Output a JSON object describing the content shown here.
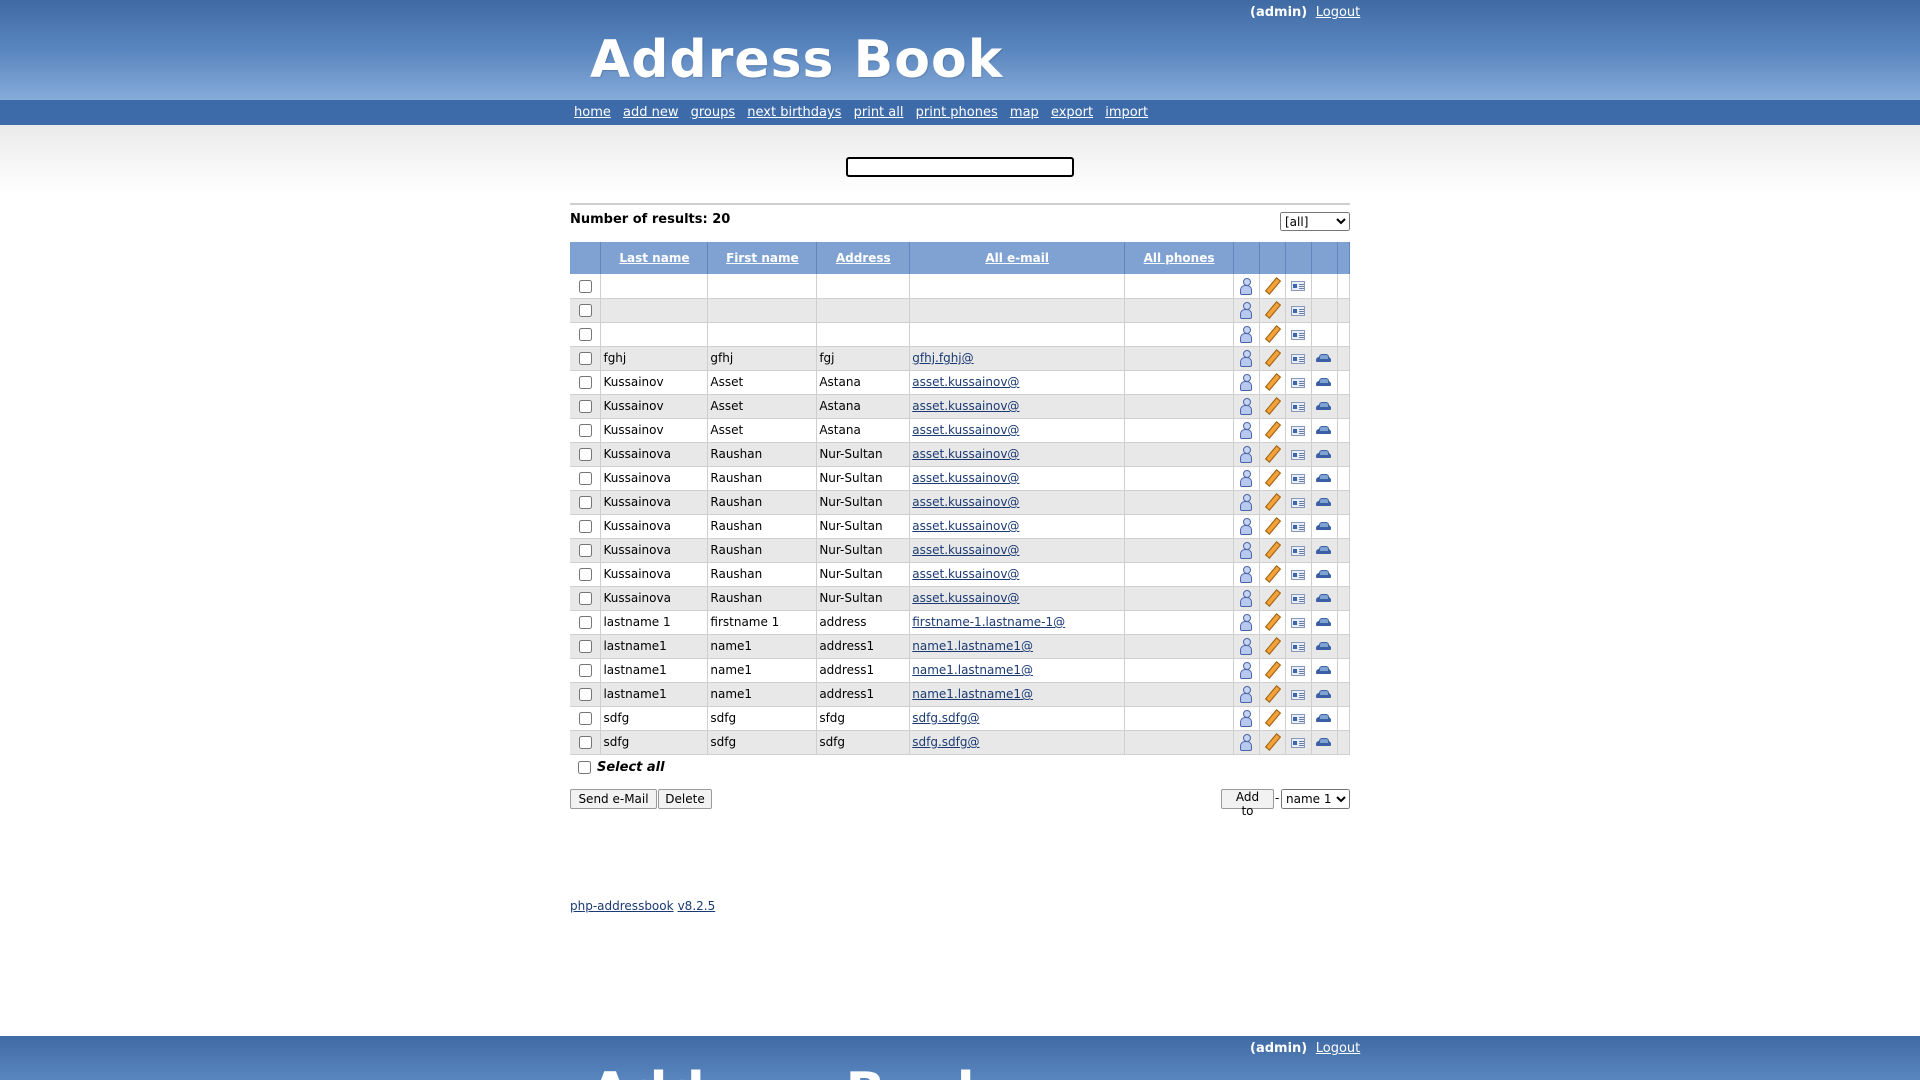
{
  "header": {
    "user_label": "(admin)",
    "logout_label": "Logout",
    "logo_text": "Address Book"
  },
  "nav": {
    "items": [
      "home",
      "add new",
      "groups",
      "next birthdays",
      "print all",
      "print phones",
      "map",
      "export",
      "import"
    ]
  },
  "search": {
    "value": ""
  },
  "results_text": "Number of results: 20",
  "group_filter": {
    "selected": "[all]"
  },
  "table": {
    "headers": {
      "last_name": "Last name",
      "first_name": "First name",
      "address": "Address",
      "email": "All e-mail",
      "phones": "All phones"
    },
    "rows": [
      {
        "last": "",
        "first": "",
        "address": "",
        "email": "",
        "phones": "",
        "car": false
      },
      {
        "last": "",
        "first": "",
        "address": "",
        "email": "",
        "phones": "",
        "car": false
      },
      {
        "last": "",
        "first": "",
        "address": "",
        "email": "",
        "phones": "",
        "car": false
      },
      {
        "last": "fghj",
        "first": "gfhj",
        "address": "fgj",
        "email": "gfhj.fghj@",
        "phones": "",
        "car": true
      },
      {
        "last": "Kussainov",
        "first": "Asset",
        "address": "Astana",
        "email": "asset.kussainov@",
        "phones": "",
        "car": true
      },
      {
        "last": "Kussainov",
        "first": "Asset",
        "address": "Astana",
        "email": "asset.kussainov@",
        "phones": "",
        "car": true
      },
      {
        "last": "Kussainov",
        "first": "Asset",
        "address": "Astana",
        "email": "asset.kussainov@",
        "phones": "",
        "car": true
      },
      {
        "last": "Kussainova",
        "first": "Raushan",
        "address": "Nur-Sultan",
        "email": "asset.kussainov@",
        "phones": "",
        "car": true
      },
      {
        "last": "Kussainova",
        "first": "Raushan",
        "address": "Nur-Sultan",
        "email": "asset.kussainov@",
        "phones": "",
        "car": true
      },
      {
        "last": "Kussainova",
        "first": "Raushan",
        "address": "Nur-Sultan",
        "email": "asset.kussainov@",
        "phones": "",
        "car": true
      },
      {
        "last": "Kussainova",
        "first": "Raushan",
        "address": "Nur-Sultan",
        "email": "asset.kussainov@",
        "phones": "",
        "car": true
      },
      {
        "last": "Kussainova",
        "first": "Raushan",
        "address": "Nur-Sultan",
        "email": "asset.kussainov@",
        "phones": "",
        "car": true
      },
      {
        "last": "Kussainova",
        "first": "Raushan",
        "address": "Nur-Sultan",
        "email": "asset.kussainov@",
        "phones": "",
        "car": true
      },
      {
        "last": "Kussainova",
        "first": "Raushan",
        "address": "Nur-Sultan",
        "email": "asset.kussainov@",
        "phones": "",
        "car": true
      },
      {
        "last": "lastname 1",
        "first": "firstname 1",
        "address": "address",
        "email": "firstname-1.lastname-1@",
        "phones": "",
        "car": true
      },
      {
        "last": "lastname1",
        "first": "name1",
        "address": "address1",
        "email": "name1.lastname1@",
        "phones": "",
        "car": true
      },
      {
        "last": "lastname1",
        "first": "name1",
        "address": "address1",
        "email": "name1.lastname1@",
        "phones": "",
        "car": true
      },
      {
        "last": "lastname1",
        "first": "name1",
        "address": "address1",
        "email": "name1.lastname1@",
        "phones": "",
        "car": true
      },
      {
        "last": "sdfg",
        "first": "sdfg",
        "address": "sfdg",
        "email": "sdfg.sdfg@",
        "phones": "",
        "car": true
      },
      {
        "last": "sdfg",
        "first": "sdfg",
        "address": "sdfg",
        "email": "sdfg.sdfg@",
        "phones": "",
        "car": true
      }
    ]
  },
  "select_all_label": "Select all",
  "buttons": {
    "send_email": "Send e-Mail",
    "delete": "Delete",
    "add_to": "Add to",
    "add_to_separator": "-"
  },
  "add_to_group": {
    "selected": "name 1"
  },
  "footer": {
    "app_name": "php-addressbook",
    "version": "v8.2.5"
  },
  "colors": {
    "header_blue": "#3f6aa3",
    "nav_blue": "#3d6aa8",
    "table_header": "#7fa2d3",
    "link": "#1b3a73"
  }
}
